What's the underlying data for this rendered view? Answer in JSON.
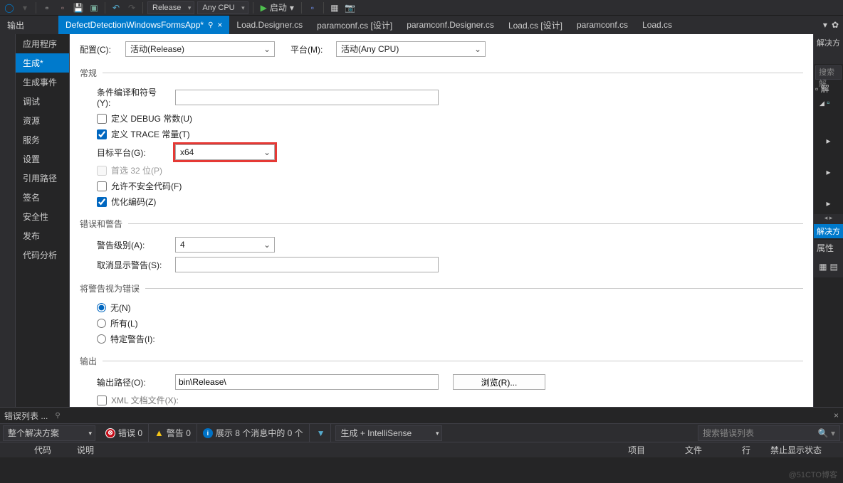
{
  "toolbar": {
    "config_release": "Release",
    "config_cpu": "Any CPU",
    "run_label": "启动"
  },
  "doc_tabs": {
    "left_label": "输出",
    "items": [
      "DefectDetectionWindowsFormsApp*",
      "Load.Designer.cs",
      "paramconf.cs [设计]",
      "paramconf.Designer.cs",
      "Load.cs [设计]",
      "paramconf.cs",
      "Load.cs"
    ]
  },
  "sidebar": {
    "items": [
      "应用程序",
      "生成*",
      "生成事件",
      "调试",
      "资源",
      "服务",
      "设置",
      "引用路径",
      "签名",
      "安全性",
      "发布",
      "代码分析"
    ]
  },
  "content": {
    "config_label": "配置(C):",
    "config_value": "活动(Release)",
    "platform_label": "平台(M):",
    "platform_value": "活动(Any CPU)",
    "section_general": "常规",
    "cond_symbols_label": "条件编译和符号(Y):",
    "define_debug_label": "定义 DEBUG 常数(U)",
    "define_trace_label": "定义 TRACE 常量(T)",
    "target_platform_label": "目标平台(G):",
    "target_platform_value": "x64",
    "prefer_32_label": "首选 32 位(P)",
    "allow_unsafe_label": "允许不安全代码(F)",
    "optimize_label": "优化编码(Z)",
    "section_errors": "错误和警告",
    "warn_level_label": "警告级别(A):",
    "warn_level_value": "4",
    "suppress_warn_label": "取消显示警告(S):",
    "section_warn_as_err": "将警告视为错误",
    "radio_none": "无(N)",
    "radio_all": "所有(L)",
    "radio_specific": "特定警告(I):",
    "section_output": "输出",
    "output_path_label": "输出路径(O):",
    "output_path_value": "bin\\Release\\",
    "browse_label": "浏览(R)...",
    "xml_doc_label": "XML 文档文件(X):"
  },
  "right_panel": {
    "title": "解决方",
    "search_placeholder": "搜索解",
    "node1": "解",
    "footer": "解决方",
    "properties": "属性"
  },
  "error_panel": {
    "tab_label": "错误列表 ...",
    "scope_label": "整个解决方案",
    "errors_label": "错误 0",
    "warnings_label": "警告 0",
    "messages_label": "展示 8 个消息中的 0 个",
    "build_label": "生成 + IntelliSense",
    "search_placeholder": "搜索错误列表",
    "headers": {
      "code": "代码",
      "desc": "说明",
      "project": "项目",
      "file": "文件",
      "line": "行",
      "suppress": "禁止显示状态"
    }
  },
  "watermark": "@51CTO博客"
}
